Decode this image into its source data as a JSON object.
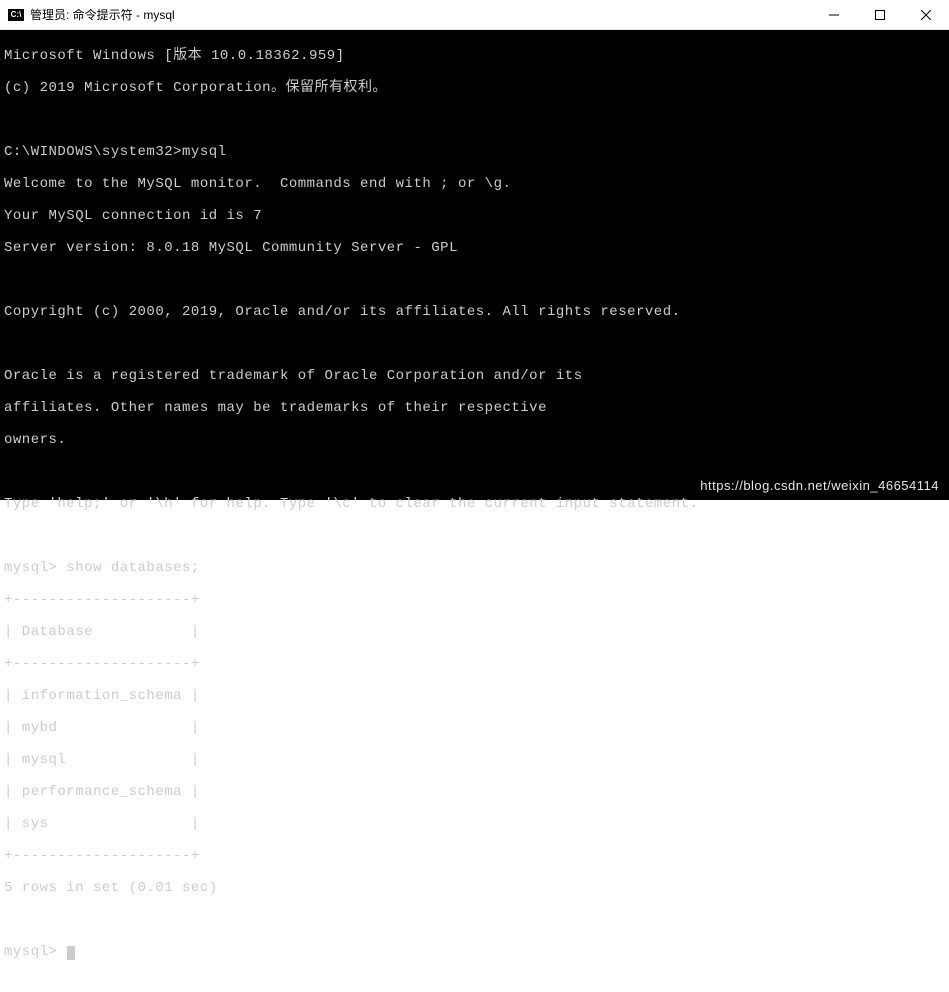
{
  "window": {
    "icon_label": "C:\\",
    "title": "管理员: 命令提示符 - mysql"
  },
  "controls": {
    "minimize": "—",
    "maximize": "□",
    "close": "×"
  },
  "terminal": {
    "l01": "Microsoft Windows [版本 10.0.18362.959]",
    "l02": "(c) 2019 Microsoft Corporation。保留所有权利。",
    "l03": "",
    "l04": "C:\\WINDOWS\\system32>mysql",
    "l05": "Welcome to the MySQL monitor.  Commands end with ; or \\g.",
    "l06": "Your MySQL connection id is 7",
    "l07": "Server version: 8.0.18 MySQL Community Server - GPL",
    "l08": "",
    "l09": "Copyright (c) 2000, 2019, Oracle and/or its affiliates. All rights reserved.",
    "l10": "",
    "l11": "Oracle is a registered trademark of Oracle Corporation and/or its",
    "l12": "affiliates. Other names may be trademarks of their respective",
    "l13": "owners.",
    "l14": "",
    "l15": "Type 'help;' or '\\h' for help. Type '\\c' to clear the current input statement.",
    "l16": "",
    "l17": "mysql> show databases;",
    "l18": "+--------------------+",
    "l19": "| Database           |",
    "l20": "+--------------------+",
    "l21": "| information_schema |",
    "l22": "| mybd               |",
    "l23": "| mysql              |",
    "l24": "| performance_schema |",
    "l25": "| sys                |",
    "l26": "+--------------------+",
    "l27": "5 rows in set (0.01 sec)",
    "l28": "",
    "l29": "mysql>"
  },
  "watermark": "https://blog.csdn.net/weixin_46654114"
}
